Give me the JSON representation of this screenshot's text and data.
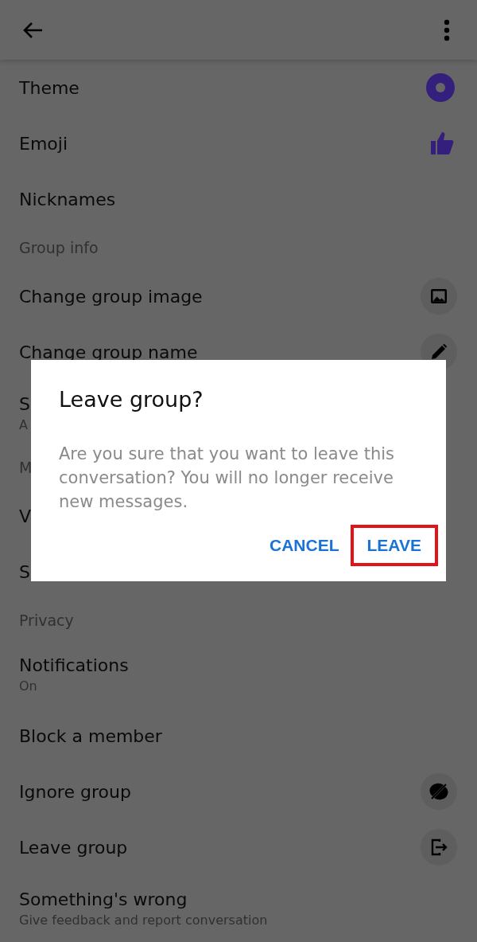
{
  "items": [
    {
      "kind": "row",
      "title": "Theme"
    },
    {
      "kind": "row",
      "title": "Emoji"
    },
    {
      "kind": "row",
      "title": "Nicknames"
    },
    {
      "kind": "section",
      "title": "Group info"
    },
    {
      "kind": "row",
      "title": "Change group image"
    },
    {
      "kind": "row",
      "title": "Change group name"
    },
    {
      "kind": "row",
      "title": "S",
      "subtitle": "A"
    },
    {
      "kind": "section",
      "title": "M"
    },
    {
      "kind": "row",
      "title": "V"
    },
    {
      "kind": "row",
      "title": "S"
    },
    {
      "kind": "section",
      "title": "Privacy"
    },
    {
      "kind": "row",
      "title": "Notifications",
      "subtitle": "On"
    },
    {
      "kind": "row",
      "title": "Block a member"
    },
    {
      "kind": "row",
      "title": "Ignore group"
    },
    {
      "kind": "row",
      "title": "Leave group"
    },
    {
      "kind": "row",
      "title": "Something's wrong",
      "subtitle": "Give feedback and report conversation"
    }
  ],
  "dialog": {
    "title": "Leave group?",
    "message": "Are you sure that you want to leave this conversation? You will no longer receive new messages.",
    "actions": [
      {
        "label": "CANCEL",
        "highlighted": false
      },
      {
        "label": "LEAVE",
        "highlighted": true
      }
    ]
  }
}
